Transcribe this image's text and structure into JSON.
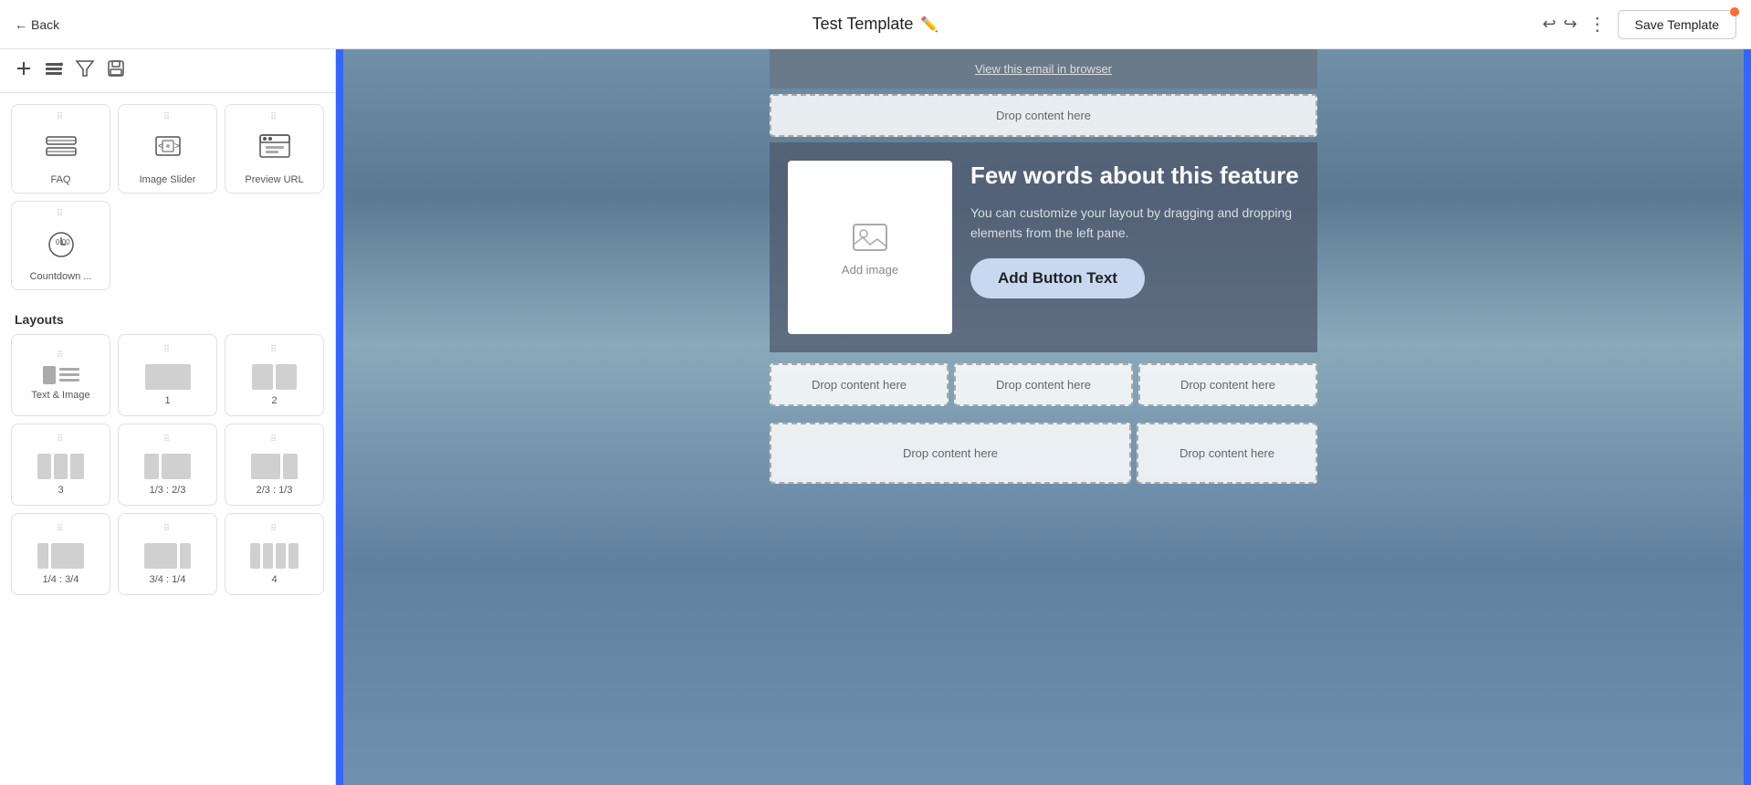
{
  "topbar": {
    "back_label": "Back",
    "title": "Test Template",
    "more_icon": "⋮",
    "save_label": "Save Template",
    "undo_icon": "↩",
    "redo_icon": "↪"
  },
  "toolbar": {
    "add_icon": "+",
    "layers_icon": "⊞",
    "settings_icon": "⚙",
    "save_icon": "💾"
  },
  "components": [
    {
      "id": "faq",
      "label": "FAQ"
    },
    {
      "id": "image-slider",
      "label": "Image Slider"
    },
    {
      "id": "preview-url",
      "label": "Preview URL"
    },
    {
      "id": "countdown",
      "label": "Countdown ..."
    }
  ],
  "layouts_title": "Layouts",
  "layouts": [
    {
      "id": "text-image",
      "label": "Text & Image",
      "type": "text-image"
    },
    {
      "id": "1col",
      "label": "1",
      "type": "1"
    },
    {
      "id": "2col",
      "label": "2",
      "type": "2"
    },
    {
      "id": "3col",
      "label": "3",
      "type": "3"
    },
    {
      "id": "1-3-2-3",
      "label": "1/3 : 2/3",
      "type": "1-3-2-3"
    },
    {
      "id": "2-3-1-3",
      "label": "2/3 : 1/3",
      "type": "2-3-1-3"
    },
    {
      "id": "1-4-3-4",
      "label": "1/4 : 3/4",
      "type": "1-4-3-4"
    },
    {
      "id": "3-4-1-4",
      "label": "3/4 : 1/4",
      "type": "3-4-1-4"
    },
    {
      "id": "4col",
      "label": "4",
      "type": "4"
    }
  ],
  "canvas": {
    "browser_link": "View this email in browser",
    "drop_content": "Drop content here",
    "feature_heading": "Few words about this feature",
    "feature_desc": "You can customize your layout by dragging and dropping elements from the left pane.",
    "add_image": "Add image",
    "add_button": "Add Button Text"
  }
}
